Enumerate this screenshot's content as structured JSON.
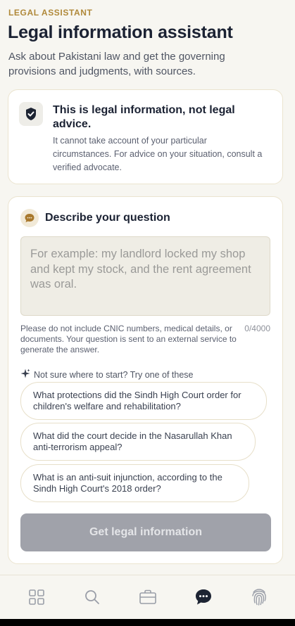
{
  "header": {
    "eyebrow": "LEGAL ASSISTANT",
    "title": "Legal information assistant",
    "subtitle": "Ask about Pakistani law and get the governing provisions and judgments, with sources."
  },
  "notice": {
    "icon": "shield-check-icon",
    "title": "This is legal information, not legal advice.",
    "body": "It cannot take account of your particular circumstances. For advice on your situation, consult a verified advocate."
  },
  "question": {
    "icon": "chat-bubble-icon",
    "title": "Describe your question",
    "placeholder": "For example: my landlord locked my shop and kept my stock, and the rent agreement was oral.",
    "value": "",
    "privacy_note": "Please do not include CNIC numbers, medical details, or documents. Your question is sent to an external service to generate the answer.",
    "char_count": "0/4000",
    "suggest_hint": "Not sure where to start? Try one of these",
    "suggestions": [
      "What protections did the Sindh High Court order for children's welfare and rehabilitation?",
      "What did the court decide in the Nasarullah Khan anti-terrorism appeal?",
      "What is an anti-suit injunction, according to the Sindh High Court's 2018 order?"
    ],
    "submit_label": "Get legal information"
  },
  "nav": {
    "items": [
      {
        "icon": "grid-icon",
        "active": false
      },
      {
        "icon": "search-icon",
        "active": false
      },
      {
        "icon": "briefcase-icon",
        "active": false
      },
      {
        "icon": "chat-icon",
        "active": true
      },
      {
        "icon": "fingerprint-icon",
        "active": false
      }
    ]
  },
  "colors": {
    "accent": "#b0893a",
    "active_nav": "#1d2433",
    "inactive_nav": "#9a9ea8",
    "disabled_button": "#a0a2aa"
  }
}
